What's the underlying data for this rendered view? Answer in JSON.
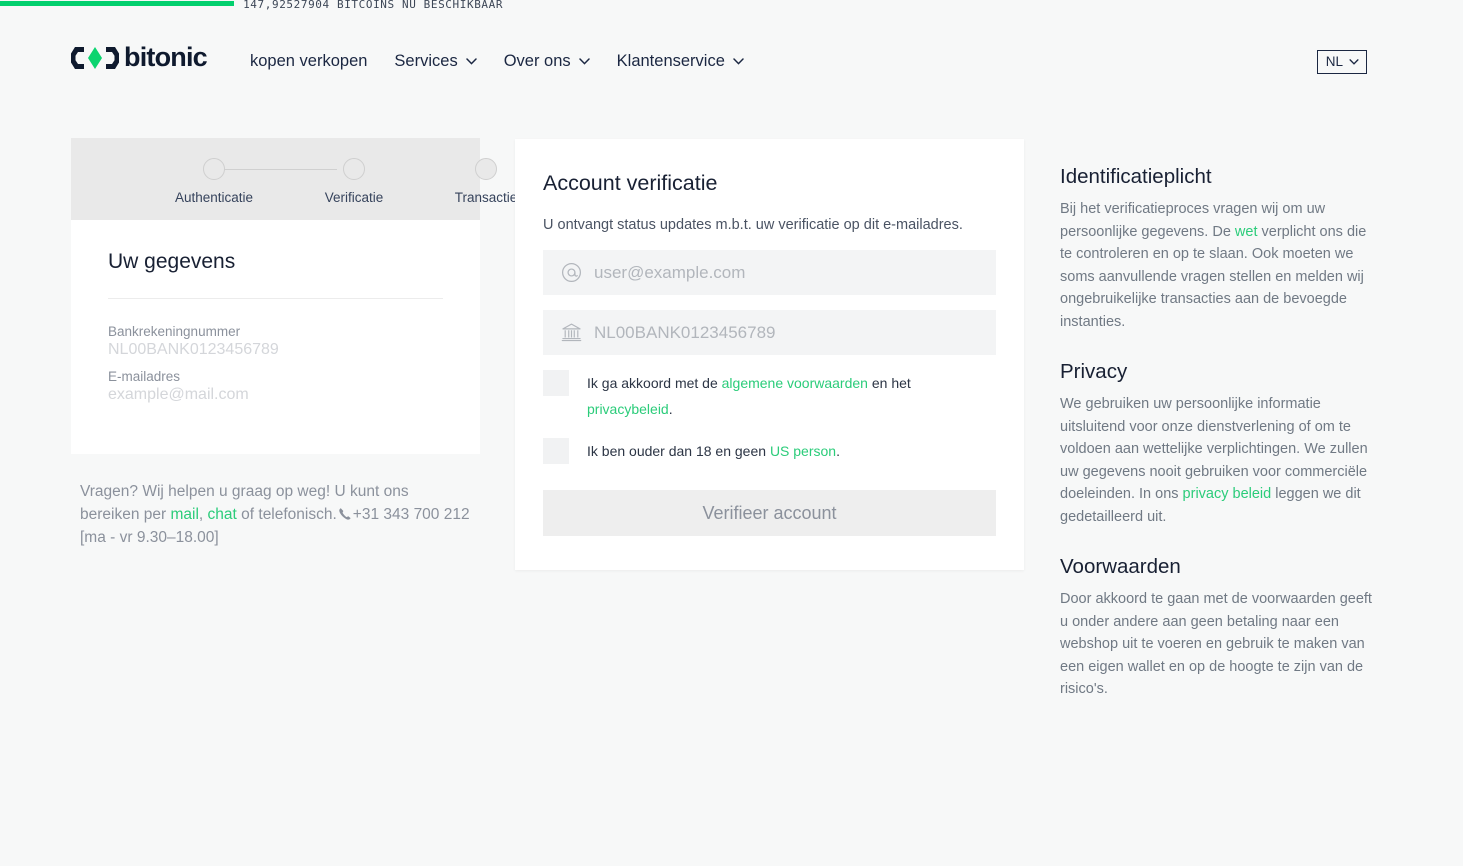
{
  "ticker": {
    "text": "147,92527904 BITCOINS NU BESCHIKBAAR",
    "progress_percent": 16
  },
  "colors": {
    "accent_green": "#03d06e",
    "link_green": "#2bcc7a",
    "brand_navy": "#0f1a2e",
    "page_bg": "#f7f8f8"
  },
  "header": {
    "logo_text": "bitonic",
    "logo_icon": "bitonic-diamond-logo",
    "nav": [
      {
        "label": "kopen verkopen",
        "has_dropdown": false
      },
      {
        "label": "Services",
        "has_dropdown": true
      },
      {
        "label": "Over ons",
        "has_dropdown": true
      },
      {
        "label": "Klantenservice",
        "has_dropdown": true
      }
    ],
    "language": {
      "value": "NL",
      "icon": "chevron-down-icon"
    }
  },
  "stepper": {
    "steps": [
      {
        "label": "Authenticatie"
      },
      {
        "label": "Verificatie"
      },
      {
        "label": "Transactie"
      }
    ]
  },
  "details": {
    "title": "Uw gegevens",
    "fields": [
      {
        "label": "Bankrekeningnummer",
        "value": "NL00BANK0123456789"
      },
      {
        "label": "E-mailadres",
        "value": "example@mail.com"
      }
    ]
  },
  "help": {
    "part1": "Vragen? Wij helpen u graag op weg! U kunt ons bereiken per ",
    "mail_link": "mail",
    "separator": ", ",
    "chat_link": "chat",
    "part2": " of telefonisch.",
    "phone_icon": "phone-icon",
    "phone": "+31 343 700 212",
    "hours": "[ma - vr 9.30–18.00]"
  },
  "main": {
    "title": "Account verificatie",
    "subtitle": "U ontvangt status updates m.b.t. uw verificatie op dit e-mailadres.",
    "email_field": {
      "icon": "at-sign-icon",
      "icon_glyph": "@",
      "value": "",
      "placeholder": "user@example.com"
    },
    "iban_field": {
      "icon": "bank-icon",
      "icon_glyph": "🏦",
      "value": "",
      "placeholder": "NL00BANK0123456789"
    },
    "checkbox_terms": {
      "checked": false,
      "text_before": "Ik ga akkoord met de ",
      "link1": "algemene voorwaarden",
      "text_middle": " en het ",
      "link2": "privacybeleid",
      "text_after": "."
    },
    "checkbox_age": {
      "checked": false,
      "text_before": "Ik ben ouder dan 18 en geen ",
      "link1": "US person",
      "text_after": "."
    },
    "submit_label": "Verifieer account"
  },
  "sidebar": {
    "sections": [
      {
        "heading": "Identificatieplicht",
        "text_before": "Bij het verificatieproces vragen wij om uw persoonlijke gegevens. De ",
        "link": "wet",
        "text_after": " verplicht ons die te controleren en op te slaan. Ook moeten we soms aanvullende vragen stellen en melden wij ongebruikelijke transacties aan de bevoegde instanties."
      },
      {
        "heading": "Privacy",
        "text_before": "We gebruiken uw persoonlijke informatie uitsluitend voor onze dienstverlening of om te voldoen aan wettelijke verplichtingen. We zullen uw gegevens nooit gebruiken voor commerciële doeleinden. In ons ",
        "link": "privacy beleid",
        "text_after": " leggen we dit gedetailleerd uit."
      },
      {
        "heading": "Voorwaarden",
        "text_before": "Door akkoord te gaan met de voorwaarden geeft u onder andere aan geen betaling naar een webshop uit te voeren en gebruik te maken van een eigen wallet en op de hoogte te zijn van de risico's.",
        "link": "",
        "text_after": ""
      }
    ]
  }
}
